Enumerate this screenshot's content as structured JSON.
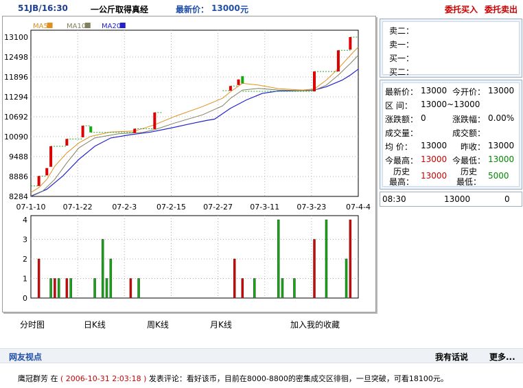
{
  "header": {
    "code_time": "51JB/16:30",
    "product_name": "一公斤取得真经",
    "price_label": "最新价：",
    "price_value": "13000",
    "price_unit": "元",
    "buy_label": "委托买入",
    "sell_label": "委托卖出"
  },
  "orderbook": {
    "rows": [
      {
        "label": "卖二：",
        "value": ""
      },
      {
        "label": "卖一：",
        "value": ""
      },
      {
        "label": "买一：",
        "value": ""
      },
      {
        "label": "买二：",
        "value": ""
      }
    ]
  },
  "quote": {
    "latest_label": "最新价：",
    "latest_value": "13000",
    "open_label": "今开价：",
    "open_value": "13000",
    "range_label": "区  间：",
    "range_value": "13000~13000",
    "change_label": "涨跌额：",
    "change_value": "0",
    "change_pct_label": "涨跌幅：",
    "change_pct_value": "0.00%",
    "volume_label": "成交量：",
    "volume_value": "",
    "amount_label": "成交额：",
    "amount_value": "",
    "avg_label": "均  价：",
    "avg_value": "13000",
    "prev_close_label": "昨收：",
    "prev_close_value": "13000",
    "today_high_label": "今最高：",
    "today_high_value": "13000",
    "today_low_label": "今最低：",
    "today_low_value": "13000",
    "hist_high_label_1": "历史",
    "hist_high_label_2": "最高：",
    "hist_high_value": "13000",
    "hist_low_label_1": "历史",
    "hist_low_label_2": "最低：",
    "hist_low_value": "5000"
  },
  "tick": {
    "time": "08:30",
    "price": "13000",
    "volume": "0"
  },
  "tabs": {
    "timeshare": "分时图",
    "daily": "日K线",
    "weekly": "周K线",
    "monthly": "月K线",
    "favorite": "加入我的收藏"
  },
  "comments": {
    "section_title": "网友视点",
    "post_link": "我有话说",
    "more_link": "更多...",
    "user": "鹰冠群芳",
    "at": "在",
    "timestamp": "( 2006-10-31 2:03:18 )",
    "text": "发表评论：看好该币，目前在8000-8800的密集成交区徘徊，一旦突破，可看18100元。"
  },
  "colors": {
    "up": "#dd0000",
    "down": "#11aa11",
    "ma5": "#e09020",
    "ma10": "#808060",
    "ma20": "#2222cc",
    "grid": "#b0b0b0"
  },
  "chart_data": {
    "type": "candlestick",
    "legend": [
      {
        "name": "MA5",
        "color": "#e09020"
      },
      {
        "name": "MA10",
        "color": "#808060"
      },
      {
        "name": "MA20",
        "color": "#2222cc"
      }
    ],
    "y_ticks": [
      "13100",
      "12498",
      "11896",
      "11294",
      "10692",
      "10090",
      "9488",
      "8886",
      "8284"
    ],
    "ylim": [
      8284,
      13100
    ],
    "x_ticks": [
      "07-1-10",
      "07-1-22",
      "07-2-3",
      "07-2-15",
      "07-2-27",
      "07-3-11",
      "07-3-23",
      "07-4-4"
    ],
    "volume_ticks": [
      "4",
      "3",
      "2",
      "1",
      "0"
    ],
    "volume_ylim": [
      0,
      4
    ],
    "candles": [
      {
        "i": 2,
        "open": 8600,
        "close": 8900,
        "up": true
      },
      {
        "i": 4,
        "open": 8920,
        "close": 9140,
        "up": true
      },
      {
        "i": 5,
        "open": 9180,
        "close": 9800,
        "up": true
      },
      {
        "i": 9,
        "open": 9820,
        "close": 10020,
        "up": true
      },
      {
        "i": 13,
        "open": 10070,
        "close": 10420,
        "up": true
      },
      {
        "i": 15,
        "open": 10400,
        "close": 10220,
        "up": false
      },
      {
        "i": 26,
        "open": 10200,
        "close": 10330,
        "up": true
      },
      {
        "i": 31,
        "open": 10320,
        "close": 10820,
        "up": true
      },
      {
        "i": 50,
        "open": 11480,
        "close": 11620,
        "up": true
      },
      {
        "i": 52,
        "open": 11650,
        "close": 11820,
        "up": true
      },
      {
        "i": 53,
        "open": 11920,
        "close": 11700,
        "up": false
      },
      {
        "i": 71,
        "open": 11460,
        "close": 12060,
        "up": true
      },
      {
        "i": 77,
        "open": 12060,
        "close": 12700,
        "up": true
      },
      {
        "i": 80,
        "open": 12720,
        "close": 13100,
        "up": true
      }
    ],
    "steps": [
      {
        "from": 0,
        "to": 2,
        "y": 8600
      },
      {
        "from": 2,
        "to": 4,
        "y": 8900
      },
      {
        "from": 5,
        "to": 9,
        "y": 9800
      },
      {
        "from": 9,
        "to": 13,
        "y": 10020
      },
      {
        "from": 13,
        "to": 15,
        "y": 10420
      },
      {
        "from": 15,
        "to": 26,
        "y": 10220
      },
      {
        "from": 26,
        "to": 31,
        "y": 10330
      },
      {
        "from": 31,
        "to": 33,
        "y": 10820
      },
      {
        "from": 48,
        "to": 50,
        "y": 11480
      },
      {
        "from": 50,
        "to": 52,
        "y": 11620
      },
      {
        "from": 53,
        "to": 71,
        "y": 11460
      },
      {
        "from": 71,
        "to": 77,
        "y": 12060
      },
      {
        "from": 77,
        "to": 80,
        "y": 12700
      },
      {
        "from": 80,
        "to": 82,
        "y": 13100
      }
    ],
    "ma5": [
      [
        0,
        8400
      ],
      [
        2,
        8550
      ],
      [
        4,
        8800
      ],
      [
        6,
        9200
      ],
      [
        9,
        9600
      ],
      [
        12,
        9900
      ],
      [
        15,
        10100
      ],
      [
        20,
        10230
      ],
      [
        26,
        10260
      ],
      [
        31,
        10450
      ],
      [
        36,
        10700
      ],
      [
        43,
        11000
      ],
      [
        48,
        11250
      ],
      [
        50,
        11450
      ],
      [
        53,
        11700
      ],
      [
        57,
        11650
      ],
      [
        62,
        11540
      ],
      [
        68,
        11500
      ],
      [
        71,
        11530
      ],
      [
        74,
        11800
      ],
      [
        77,
        12150
      ],
      [
        80,
        12550
      ],
      [
        82,
        12800
      ]
    ],
    "ma10": [
      [
        0,
        8300
      ],
      [
        3,
        8450
      ],
      [
        6,
        8800
      ],
      [
        9,
        9300
      ],
      [
        12,
        9750
      ],
      [
        16,
        10050
      ],
      [
        22,
        10180
      ],
      [
        28,
        10220
      ],
      [
        31,
        10300
      ],
      [
        36,
        10500
      ],
      [
        43,
        10750
      ],
      [
        48,
        11020
      ],
      [
        50,
        11250
      ],
      [
        53,
        11500
      ],
      [
        57,
        11550
      ],
      [
        62,
        11500
      ],
      [
        68,
        11480
      ],
      [
        71,
        11490
      ],
      [
        74,
        11650
      ],
      [
        77,
        11950
      ],
      [
        80,
        12300
      ],
      [
        82,
        12550
      ]
    ],
    "ma20": [
      [
        0,
        8284
      ],
      [
        4,
        8500
      ],
      [
        8,
        8900
      ],
      [
        12,
        9400
      ],
      [
        16,
        9800
      ],
      [
        20,
        10050
      ],
      [
        25,
        10150
      ],
      [
        30,
        10230
      ],
      [
        35,
        10350
      ],
      [
        40,
        10480
      ],
      [
        44,
        10580
      ],
      [
        46,
        10620
      ],
      [
        50,
        10950
      ],
      [
        54,
        11200
      ],
      [
        58,
        11400
      ],
      [
        62,
        11470
      ],
      [
        68,
        11480
      ],
      [
        71,
        11500
      ],
      [
        74,
        11600
      ],
      [
        78,
        11800
      ],
      [
        80,
        11950
      ],
      [
        82,
        12130
      ]
    ],
    "volumes": [
      {
        "i": 2,
        "v": 2,
        "up": true
      },
      {
        "i": 5,
        "v": 1,
        "up": false
      },
      {
        "i": 6,
        "v": 1,
        "up": true
      },
      {
        "i": 7,
        "v": 1,
        "up": false
      },
      {
        "i": 9,
        "v": 1,
        "up": true
      },
      {
        "i": 10,
        "v": 1,
        "up": false
      },
      {
        "i": 16,
        "v": 1,
        "up": false
      },
      {
        "i": 18,
        "v": 3,
        "up": false
      },
      {
        "i": 19,
        "v": 1,
        "up": false
      },
      {
        "i": 20,
        "v": 2,
        "up": false
      },
      {
        "i": 25,
        "v": 1,
        "up": true
      },
      {
        "i": 27,
        "v": 1,
        "up": false
      },
      {
        "i": 51,
        "v": 2,
        "up": true
      },
      {
        "i": 53,
        "v": 1,
        "up": true
      },
      {
        "i": 56,
        "v": 1,
        "up": false
      },
      {
        "i": 62,
        "v": 4,
        "up": false
      },
      {
        "i": 63,
        "v": 1,
        "up": false
      },
      {
        "i": 66,
        "v": 1,
        "up": false
      },
      {
        "i": 71,
        "v": 3,
        "up": true
      },
      {
        "i": 74,
        "v": 4,
        "up": false
      },
      {
        "i": 79,
        "v": 2,
        "up": false
      },
      {
        "i": 80,
        "v": 4,
        "up": true
      }
    ]
  }
}
